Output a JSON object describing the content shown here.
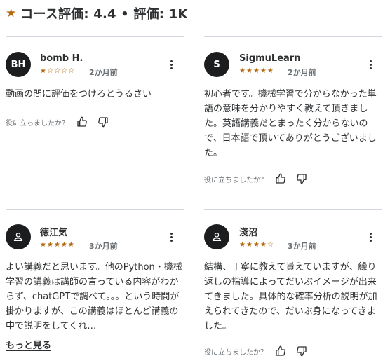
{
  "header": {
    "title": "コース評価: 4.4 • 評価: 1K",
    "star_icon": "star-icon",
    "accent": "#b4690e"
  },
  "reviews": [
    {
      "initials": "BH",
      "name": "bomb H.",
      "rating": 1,
      "time": "2か月前",
      "text": "動画の間に評価をつけろとうるさい",
      "helpful_label": "役に立ちましたか？"
    },
    {
      "initials": "S",
      "name": "SigmuLearn",
      "rating": 5,
      "time": "2か月前",
      "text": "初心者です。機械学習で分からなかった単語の意味を分かりやすく教えて頂きました。英語講義だとまったく分からないので、日本語で頂いてありがとうございました。",
      "helpful_label": "役に立ちましたか？"
    },
    {
      "initials": "",
      "name": "徳江気",
      "rating": 5,
      "time": "3か月前",
      "text": "よい講義だと思います。他のPython・機械学習の講義は講師の言っている内容がわからず、chatGPTで調べて。。。という時間が掛かりますが、この講義はほとんど講義の中で説明をしてくれ…",
      "more_label": "もっと見る"
    },
    {
      "initials": "",
      "name": "淺沼",
      "rating": 4,
      "time": "3か月前",
      "text": "結構、丁寧に教えて貰えていますが、繰り返しの指導によってだいぶイメージが出来てきました。具体的な確率分析の説明が加えられてきたので、だいぶ身になってきました。",
      "helpful_label": "役に立ちましたか？"
    }
  ]
}
